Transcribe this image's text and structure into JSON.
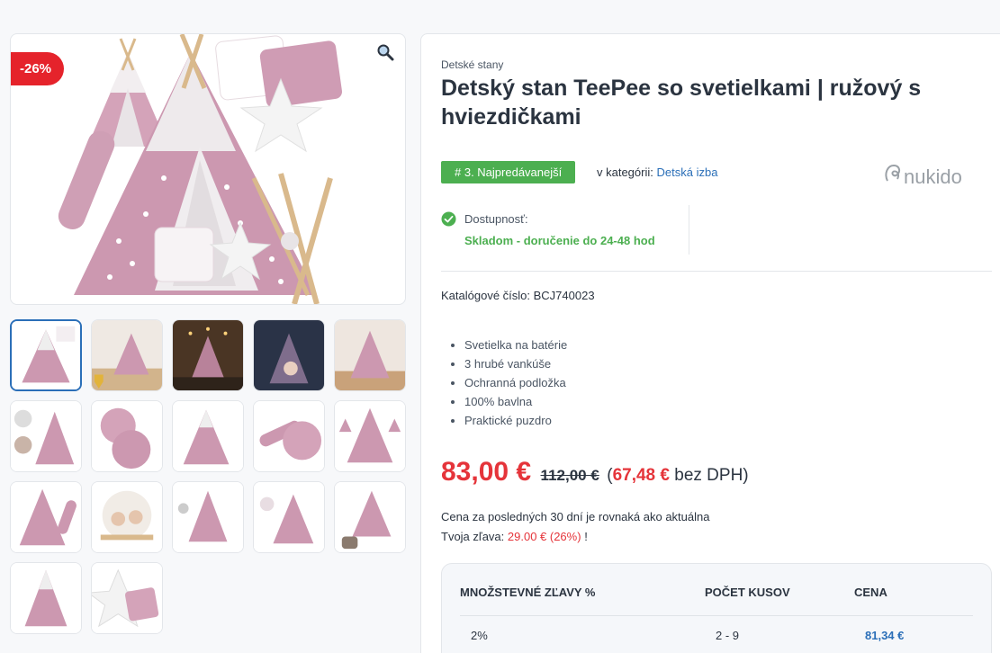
{
  "gallery": {
    "discount_badge": "-26%",
    "zoom_icon": "magnifier-icon",
    "thumbnail_count": 17
  },
  "product": {
    "breadcrumb": "Detské stany",
    "title": "Detský stan TeePee so svetielkami | ružový s hviezdičkami",
    "bestseller_badge": "# 3. Najpredávanejší",
    "category_prefix": "v kategórii:",
    "category_link": "Detská izba",
    "brand": "nukido",
    "availability_label": "Dostupnosť:",
    "availability_value": "Skladom - doručenie do 24-48 hod",
    "catalog_number": "Katalógové číslo: BCJ740023",
    "features": [
      "Svetielka na batérie",
      "3 hrubé vankúše",
      "Ochranná podložka",
      "100% bavlna",
      "Praktické puzdro"
    ],
    "price_current": "83,00 €",
    "price_old": "112,00 €",
    "price_net_open": "(",
    "price_net_value": "67,48 €",
    "price_net_suffix": "bez DPH)",
    "price_note": "Cena za posledných 30 dní je rovnaká ako aktuálna",
    "saving_prefix": "Tvoja zľava:",
    "saving_value": "29.00 € (26%)",
    "saving_suffix": "!"
  },
  "quantity_discounts": {
    "headers": [
      "MNOŽSTEVNÉ ZĽAVY %",
      "POČET KUSOV",
      "CENA"
    ],
    "rows": [
      {
        "discount": "2%",
        "pieces": "2 - 9",
        "price": "81,34 €"
      }
    ]
  },
  "colors": {
    "accent_red": "#e5343a",
    "badge_green": "#4caf50",
    "link_blue": "#2b6fb8",
    "tent_pink": "#c995ad"
  }
}
